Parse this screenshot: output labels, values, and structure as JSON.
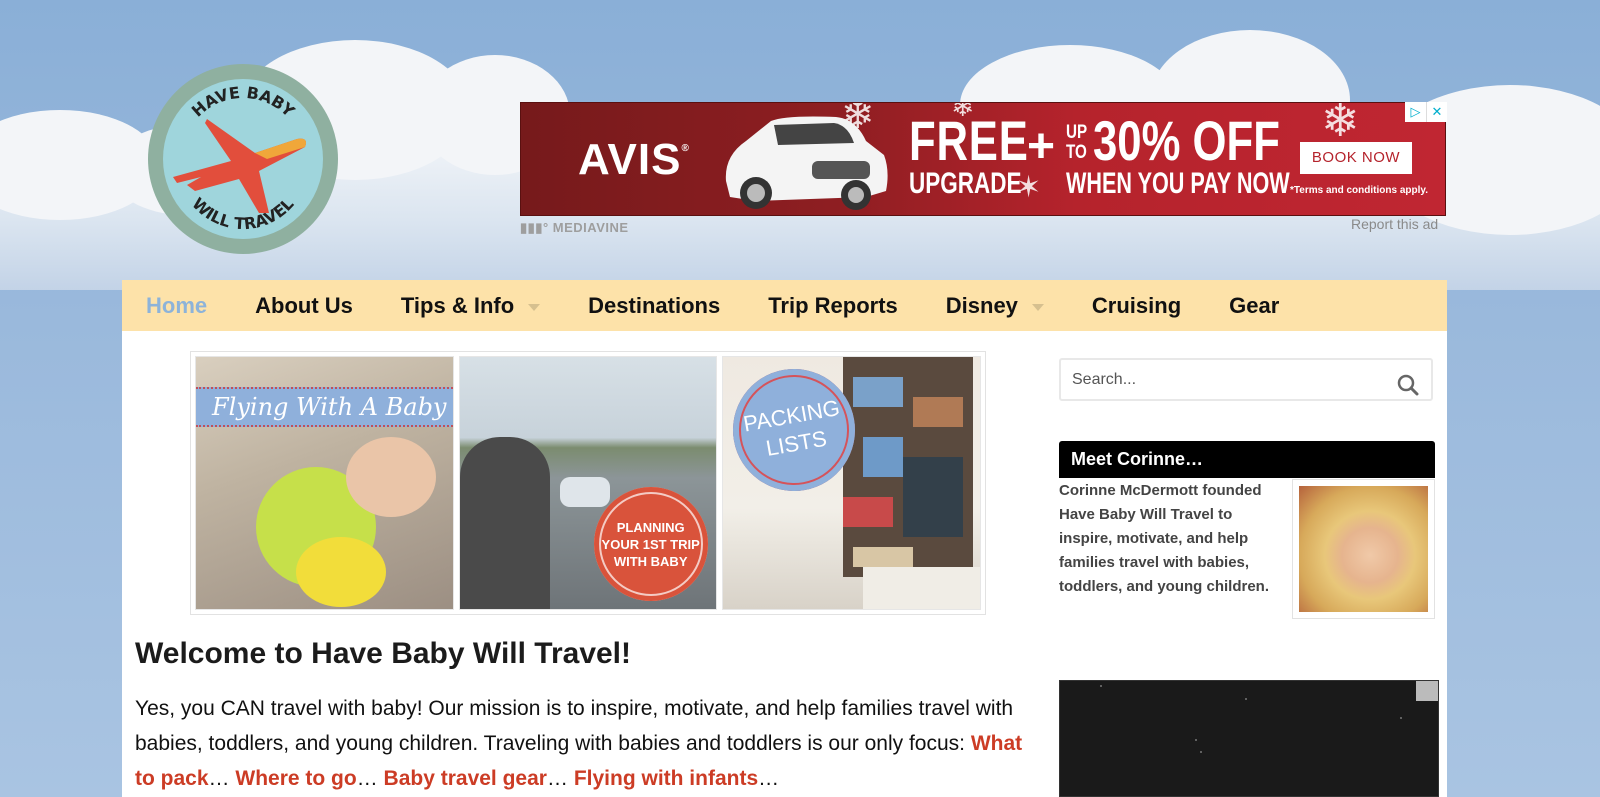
{
  "logo": {
    "top_text": "HAVE BABY",
    "bottom_text": "WILL TRAVEL",
    "icon": "airplane-icon"
  },
  "ad": {
    "brand": "AVIS",
    "headline_1": "FREE",
    "headline_1b": "UPGRADE",
    "plus": "+",
    "up": "UP",
    "to": "TO",
    "headline_2": "30% OFF",
    "headline_2b": "WHEN YOU PAY NOW",
    "cta": "BOOK NOW",
    "terms": "*Terms and conditions apply.",
    "ad_choices_icon": "▷",
    "close_icon": "✕",
    "network": "MEDIAVINE",
    "report": "Report this ad"
  },
  "nav": {
    "items": [
      {
        "label": "Home",
        "active": true,
        "dropdown": false
      },
      {
        "label": "About Us",
        "active": false,
        "dropdown": false
      },
      {
        "label": "Tips & Info",
        "active": false,
        "dropdown": true
      },
      {
        "label": "Destinations",
        "active": false,
        "dropdown": false
      },
      {
        "label": "Trip Reports",
        "active": false,
        "dropdown": false
      },
      {
        "label": "Disney",
        "active": false,
        "dropdown": true
      },
      {
        "label": "Cruising",
        "active": false,
        "dropdown": false
      },
      {
        "label": "Gear",
        "active": false,
        "dropdown": false
      }
    ]
  },
  "gallery": [
    {
      "title": "Flying With A Baby"
    },
    {
      "title": "PLANNING YOUR 1ST TRIP WITH BABY",
      "line1": "PLANNING",
      "line2": "YOUR 1ST TRIP",
      "line3": "WITH BABY"
    },
    {
      "title": "PACKING LISTS",
      "line1": "PACKING",
      "line2": "LISTS"
    }
  ],
  "main": {
    "heading": "Welcome to Have Baby Will Travel!",
    "intro_text": "Yes, you CAN travel with baby! Our mission is to inspire, motivate, and help families travel with babies, toddlers, and young children. Traveling with babies and toddlers is our only focus: ",
    "links": [
      "What to pack",
      "Where to go",
      "Baby travel gear",
      "Flying with infants"
    ],
    "separator": "…"
  },
  "sidebar": {
    "search_placeholder": "Search...",
    "meet_heading": "Meet Corinne…",
    "meet_text": "Corinne McDermott founded Have Baby Will Travel to inspire, motivate, and help families travel with babies, toddlers, and young children."
  },
  "colors": {
    "nav_bg": "#fde2a9",
    "nav_active": "#8db3d9",
    "link": "#cc3c25",
    "sky": "#8fb1d8"
  }
}
